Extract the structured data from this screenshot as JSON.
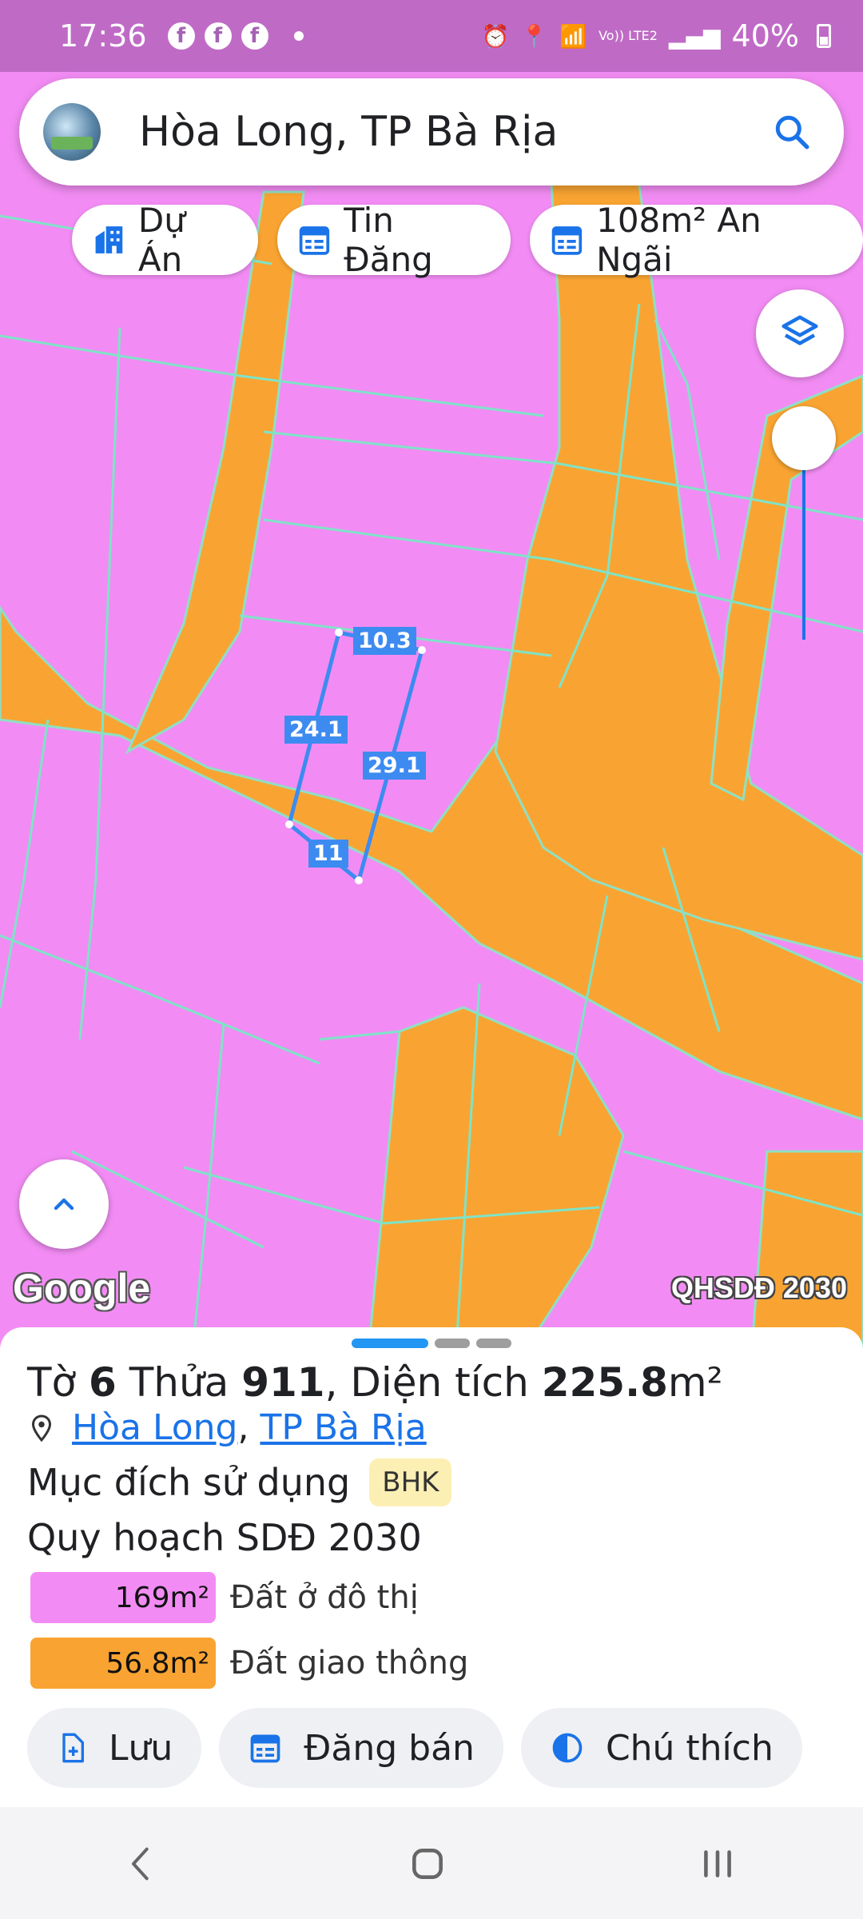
{
  "status_bar": {
    "time": "17:36",
    "fb_icons": [
      "f",
      "f",
      "f"
    ],
    "battery": "40%",
    "icons": [
      "alarm-icon",
      "location-icon",
      "wifi-icon",
      "volte-icon",
      "signal-icon"
    ],
    "volte_text": "Vo)) LTE2"
  },
  "search": {
    "text": "Hòa Long, TP Bà Rịa"
  },
  "chips": [
    {
      "label": "Dự Án",
      "icon": "building-icon"
    },
    {
      "label": "Tin Đăng",
      "icon": "listing-icon"
    },
    {
      "label": "108m² An Ngãi",
      "icon": "listing-icon"
    }
  ],
  "map": {
    "dimension_labels": [
      "10.3",
      "24.1",
      "29.1",
      "11"
    ],
    "attribution": "Google",
    "layer_name": "QHSDĐ 2030",
    "colors": {
      "residential": "#f28cf4",
      "traffic": "#f9a432",
      "parcel_line": "#7fe3c7",
      "highlight": "#3d8bf0"
    }
  },
  "parcel": {
    "sheet_label": "Tờ",
    "sheet_no": "6",
    "plot_label": "Thửa",
    "plot_no": "911",
    "area_label": ", Diện tích",
    "area_value": "225.8",
    "area_unit": "m²",
    "location_ward": "Hòa Long",
    "location_city": "TP Bà Rịa",
    "location_sep": ",",
    "purpose_label": "Mục đích sử dụng",
    "purpose_code": "BHK",
    "plan_label": "Quy hoạch SDĐ 2030",
    "land_use": [
      {
        "area": "169m²",
        "label": "Đất ở đô thị",
        "color": "#f28cf4"
      },
      {
        "area": "56.8m²",
        "label": "Đất giao thông",
        "color": "#f9a432"
      }
    ]
  },
  "actions": [
    {
      "label": "Lưu",
      "icon": "file-plus-icon"
    },
    {
      "label": "Đăng bán",
      "icon": "listing-icon"
    },
    {
      "label": "Chú thích",
      "icon": "contrast-icon"
    }
  ]
}
